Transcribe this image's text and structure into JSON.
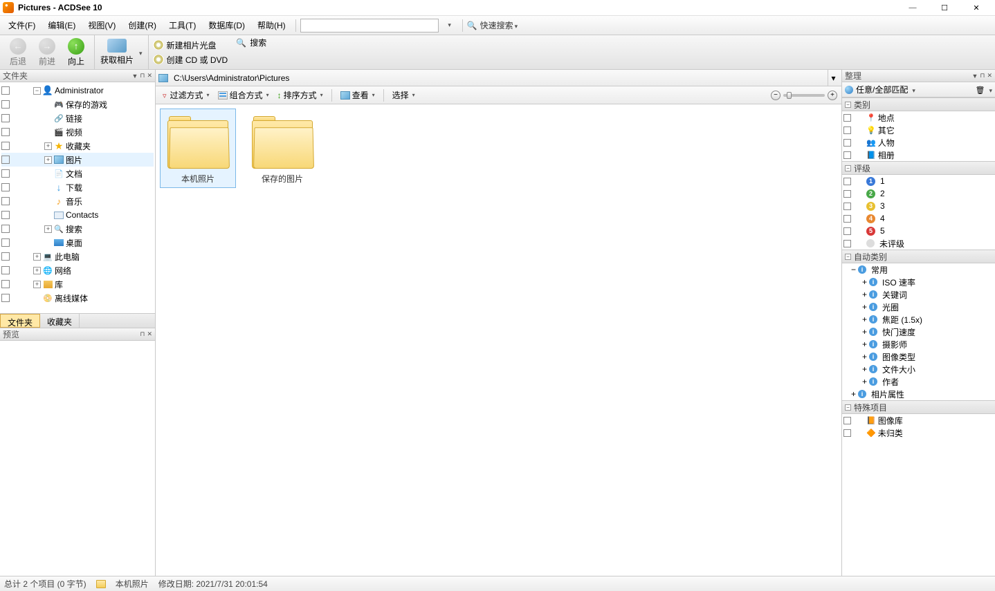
{
  "window": {
    "title": "Pictures - ACDSee 10"
  },
  "menu": {
    "file": "文件(F)",
    "edit": "编辑(E)",
    "view": "视图(V)",
    "create": "创建(R)",
    "tool": "工具(T)",
    "db": "数据库(D)",
    "help": "帮助(H)",
    "quick_search": "快速搜索"
  },
  "toolbar": {
    "back": "后退",
    "forward": "前进",
    "up": "向上",
    "get": "获取相片",
    "new_disc": "新建相片光盘",
    "create_cd": "创建 CD 或 DVD",
    "search": "搜索"
  },
  "left": {
    "folders_title": "文件夹",
    "tree": {
      "admin": "Administrator",
      "saved_games": "保存的游戏",
      "links": "链接",
      "videos": "视频",
      "favorites": "收藏夹",
      "pictures": "图片",
      "documents": "文档",
      "downloads": "下载",
      "music": "音乐",
      "contacts": "Contacts",
      "search": "搜索",
      "desktop": "桌面",
      "this_pc": "此电脑",
      "network": "网络",
      "libraries": "库",
      "offline": "离线媒体"
    },
    "tab_folders": "文件夹",
    "tab_favorites": "收藏夹",
    "preview_title": "预览"
  },
  "center": {
    "path": "C:\\Users\\Administrator\\Pictures",
    "filter": "过滤方式",
    "group": "组合方式",
    "sort": "排序方式",
    "view": "查看",
    "select": "选择",
    "folders": [
      {
        "name": "本机照片",
        "selected": true
      },
      {
        "name": "保存的图片",
        "selected": false
      }
    ]
  },
  "right": {
    "title": "整理",
    "match_any_all": "任意/全部匹配",
    "sections": {
      "categories": "类别",
      "ratings": "评级",
      "auto": "自动类别",
      "special": "特殊项目"
    },
    "categories": {
      "place": "地点",
      "misc": "其它",
      "people": "人物",
      "album": "相册"
    },
    "ratings": {
      "r1": "1",
      "r2": "2",
      "r3": "3",
      "r4": "4",
      "r5": "5",
      "unrated": "未评级"
    },
    "auto": {
      "common": "常用",
      "iso": "ISO 速率",
      "keywords": "关键词",
      "aperture": "光圈",
      "focal": "焦距 (1.5x)",
      "shutter": "快门速度",
      "photographer": "摄影师",
      "imgtype": "图像类型",
      "filesize": "文件大小",
      "author": "作者",
      "photo_attrs": "相片属性"
    },
    "special": {
      "imgdb": "图像库",
      "unsorted": "未归类"
    }
  },
  "status": {
    "count": "总计 2 个项目 (0 字节)",
    "sel_name": "本机照片",
    "modified": "修改日期: 2021/7/31 20:01:54"
  }
}
